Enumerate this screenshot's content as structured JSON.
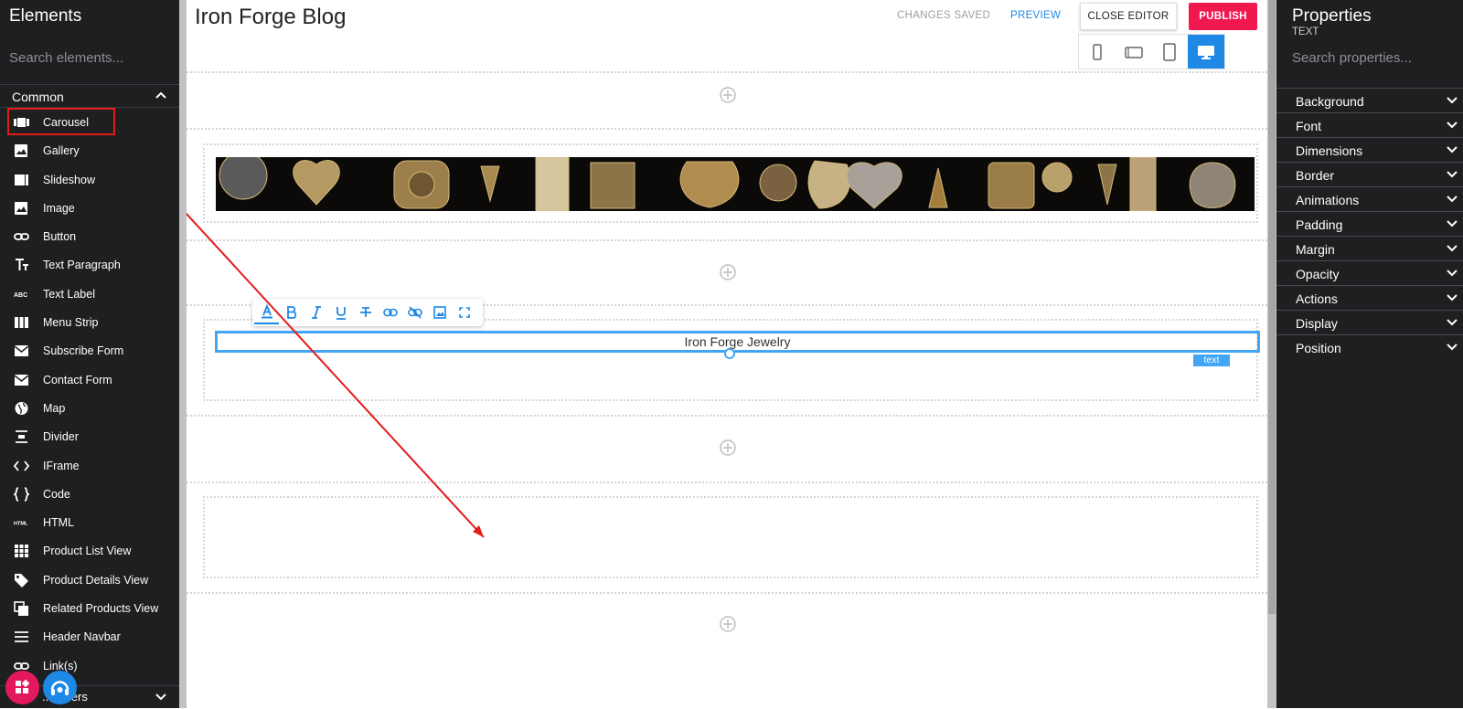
{
  "left": {
    "title": "Elements",
    "search_placeholder": "Search elements...",
    "section": "Common",
    "items": [
      {
        "label": "Carousel",
        "icon": "carousel-icon"
      },
      {
        "label": "Gallery",
        "icon": "image-icon"
      },
      {
        "label": "Slideshow",
        "icon": "slideshow-icon"
      },
      {
        "label": "Image",
        "icon": "image-icon"
      },
      {
        "label": "Button",
        "icon": "link-icon"
      },
      {
        "label": "Text Paragraph",
        "icon": "text-paragraph-icon"
      },
      {
        "label": "Text Label",
        "icon": "text-label-icon"
      },
      {
        "label": "Menu Strip",
        "icon": "menu-strip-icon"
      },
      {
        "label": "Subscribe Form",
        "icon": "mail-icon"
      },
      {
        "label": "Contact Form",
        "icon": "mail-icon"
      },
      {
        "label": "Map",
        "icon": "globe-icon"
      },
      {
        "label": "Divider",
        "icon": "divider-icon"
      },
      {
        "label": "IFrame",
        "icon": "code-icon"
      },
      {
        "label": "Code",
        "icon": "braces-icon"
      },
      {
        "label": "HTML",
        "icon": "html-icon"
      },
      {
        "label": "Product List View",
        "icon": "grid-icon"
      },
      {
        "label": "Product Details View",
        "icon": "tag-icon"
      },
      {
        "label": "Related Products View",
        "icon": "copy-icon"
      },
      {
        "label": "Header Navbar",
        "icon": "hamburger-icon"
      },
      {
        "label": "Link(s)",
        "icon": "link-icon"
      }
    ],
    "section2": "...tainers"
  },
  "canvas": {
    "blog_title": "Iron Forge Blog",
    "changes_saved": "CHANGES SAVED",
    "preview": "PREVIEW",
    "close_editor": "CLOSE EDITOR",
    "publish": "PUBLISH",
    "text_value": "Iron Forge Jewelry",
    "text_tag": "text",
    "accent": "#1e88e5",
    "publish_color": "#f0184f"
  },
  "right": {
    "title": "Properties",
    "subtitle": "TEXT",
    "search_placeholder": "Search properties...",
    "props": [
      "Background",
      "Font",
      "Dimensions",
      "Border",
      "Animations",
      "Padding",
      "Margin",
      "Opacity",
      "Actions",
      "Display",
      "Position"
    ]
  }
}
